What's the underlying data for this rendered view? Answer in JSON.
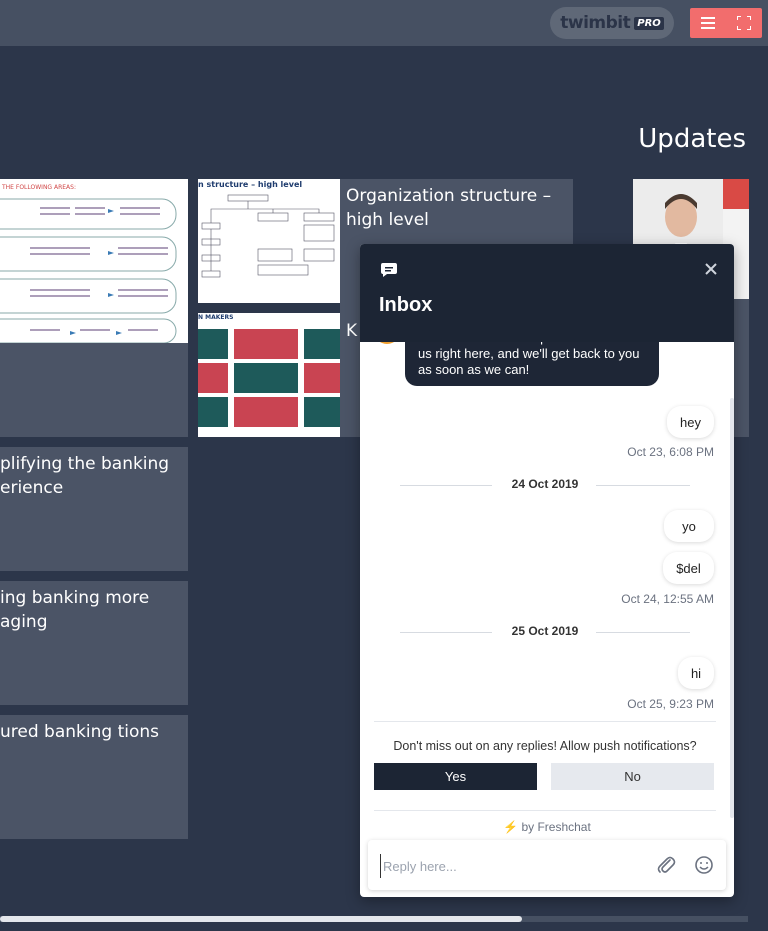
{
  "brand": {
    "name": "twimbit",
    "tag": "PRO"
  },
  "section_title": "Updates",
  "cards": {
    "c1": "plifying the banking erience",
    "c2": "ing banking more aging",
    "c3": "ured banking tions",
    "org": "Organization structure – high level",
    "k": "K"
  },
  "thumbs": {
    "t1_heading": "THE FOLLOWING AREAS:",
    "t2_heading": "n structure – high level",
    "t3_heading": "N MAKERS"
  },
  "chat": {
    "title": "Inbox",
    "bot_message": "Hello there! Need help? Reach out to us right here, and we'll get back to you as soon as we can!",
    "messages": [
      {
        "text": "hey",
        "time": "Oct 23, 6:08 PM"
      },
      {
        "date": "24 Oct 2019"
      },
      {
        "text": "yo"
      },
      {
        "text": "$del",
        "time": "Oct 24, 12:55 AM"
      },
      {
        "date": "25 Oct 2019"
      },
      {
        "text": "hi",
        "time": "Oct 25, 9:23 PM"
      }
    ],
    "push_prompt": "Don't miss out on any replies! Allow push notifications?",
    "yes_label": "Yes",
    "no_label": "No",
    "powered_by": "by Freshchat",
    "reply_placeholder": "Reply here..."
  },
  "colors": {
    "accent": "#f26d6d",
    "chat_dark": "#1c2534",
    "page_bg": "#2c364a"
  }
}
